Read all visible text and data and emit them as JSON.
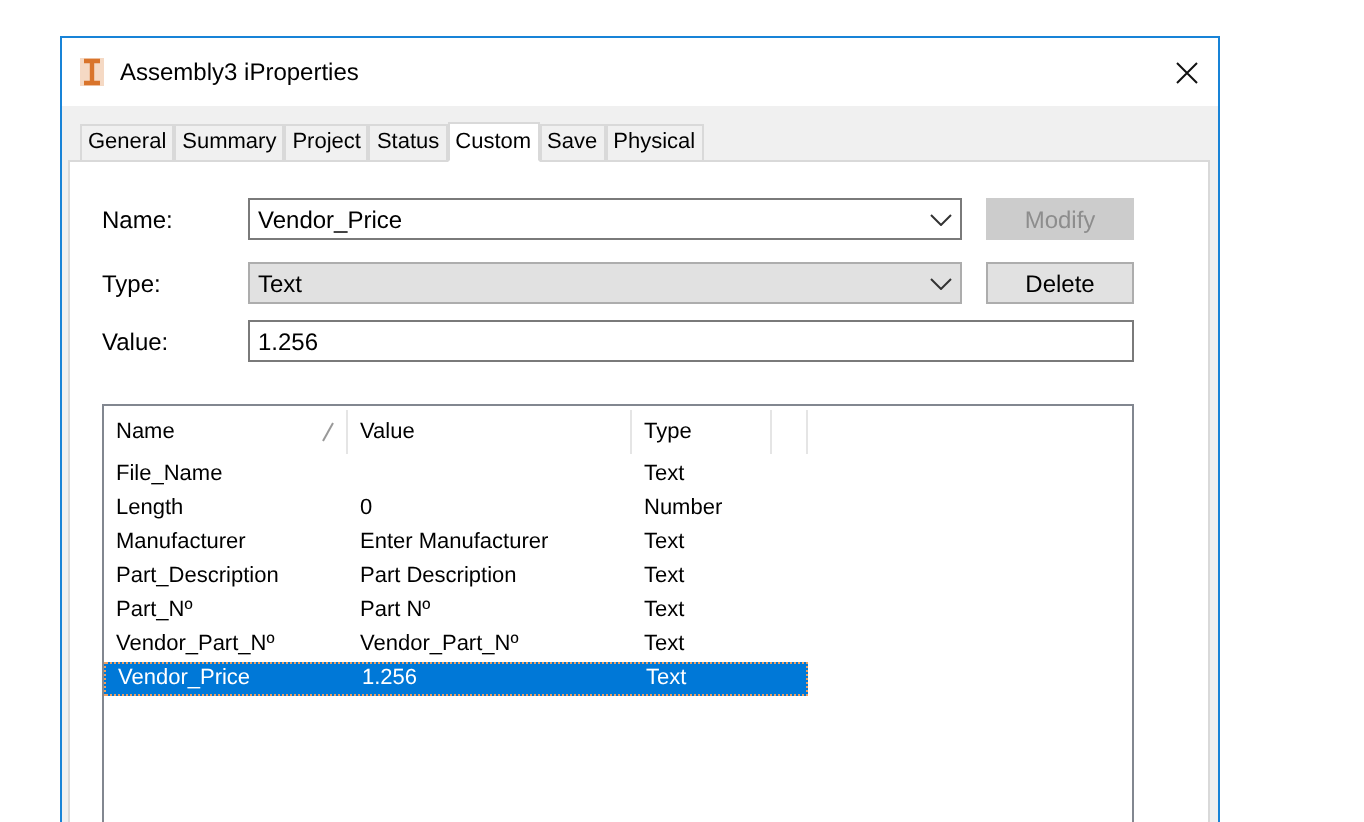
{
  "window": {
    "title": "Assembly3 iProperties"
  },
  "tabs": [
    {
      "label": "General",
      "selected": false
    },
    {
      "label": "Summary",
      "selected": false
    },
    {
      "label": "Project",
      "selected": false
    },
    {
      "label": "Status",
      "selected": false
    },
    {
      "label": "Custom",
      "selected": true
    },
    {
      "label": "Save",
      "selected": false
    },
    {
      "label": "Physical",
      "selected": false
    }
  ],
  "form": {
    "name": {
      "label": "Name:",
      "value": "Vendor_Price"
    },
    "type": {
      "label": "Type:",
      "value": "Text"
    },
    "value": {
      "label": "Value:",
      "value": "1.256"
    },
    "buttons": [
      {
        "label": "Modify",
        "disabled": true
      },
      {
        "label": "Delete",
        "disabled": false
      }
    ]
  },
  "table": {
    "columns": [
      "Name",
      "Value",
      "Type"
    ],
    "rows": [
      {
        "name": "File_Name",
        "value": "",
        "type": "Text",
        "selected": false
      },
      {
        "name": "Length",
        "value": "0",
        "type": "Number",
        "selected": false
      },
      {
        "name": "Manufacturer",
        "value": "Enter Manufacturer",
        "type": "Text",
        "selected": false
      },
      {
        "name": "Part_Description",
        "value": "Part Description",
        "type": "Text",
        "selected": false
      },
      {
        "name": "Part_Nº",
        "value": "Part Nº",
        "type": "Text",
        "selected": false
      },
      {
        "name": "Vendor_Part_Nº",
        "value": "Vendor_Part_Nº",
        "type": "Text",
        "selected": false
      },
      {
        "name": "Vendor_Price",
        "value": "1.256",
        "type": "Text",
        "selected": true
      }
    ]
  }
}
